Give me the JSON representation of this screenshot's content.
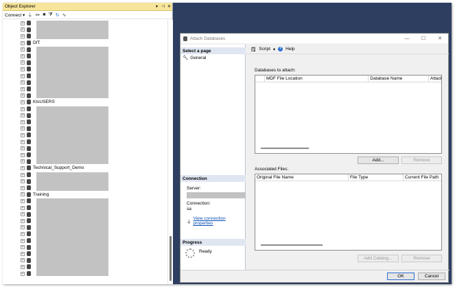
{
  "object_explorer": {
    "title": "Object Explorer",
    "pin": "▾ ⊣ ✕",
    "toolbar": {
      "connect_label": "Connect ▾"
    },
    "databases": [
      {
        "type": "redacted"
      },
      {
        "type": "redacted"
      },
      {
        "type": "redacted"
      },
      {
        "type": "named",
        "label": "DfT"
      },
      {
        "type": "redacted"
      },
      {
        "type": "redacted"
      },
      {
        "type": "redacted"
      },
      {
        "type": "redacted"
      },
      {
        "type": "redacted"
      },
      {
        "type": "redacted"
      },
      {
        "type": "redacted"
      },
      {
        "type": "redacted"
      },
      {
        "type": "named",
        "label": "KtsUSERS"
      },
      {
        "type": "redacted"
      },
      {
        "type": "redacted"
      },
      {
        "type": "redacted"
      },
      {
        "type": "redacted"
      },
      {
        "type": "redacted"
      },
      {
        "type": "redacted"
      },
      {
        "type": "redacted"
      },
      {
        "type": "redacted"
      },
      {
        "type": "redacted"
      },
      {
        "type": "named",
        "label": "Technical_Support_Demo"
      },
      {
        "type": "redacted"
      },
      {
        "type": "redacted"
      },
      {
        "type": "redacted"
      },
      {
        "type": "named",
        "label": "Training"
      },
      {
        "type": "redacted"
      },
      {
        "type": "redacted"
      },
      {
        "type": "redacted"
      },
      {
        "type": "redacted"
      },
      {
        "type": "redacted"
      },
      {
        "type": "redacted"
      },
      {
        "type": "redacted"
      },
      {
        "type": "redacted"
      },
      {
        "type": "redacted"
      },
      {
        "type": "redacted"
      },
      {
        "type": "redacted"
      },
      {
        "type": "redacted"
      }
    ]
  },
  "dialog": {
    "title": "Attach Databases",
    "select_page_heading": "Select a page",
    "pages": [
      {
        "label": "General"
      }
    ],
    "connection_heading": "Connection",
    "server_label": "Server:",
    "connection_label": "Connection:",
    "connection_value": "sa",
    "view_connection_link": "View connection properties",
    "progress_heading": "Progress",
    "progress_status": "Ready",
    "toolbar": {
      "script_label": "Script",
      "help_label": "Help"
    },
    "databases_to_attach_label": "Databases to attach:",
    "attach_columns": [
      "MDF File Location",
      "Database Name",
      "Attach"
    ],
    "add_button": "Add...",
    "remove_button": "Remove",
    "associated_files_label": "Associated Files:",
    "assoc_columns": [
      "Original File Name",
      "File Type",
      "Current File Path"
    ],
    "add_catalog_button": "Add Catalog...",
    "remove_button_2": "Remove",
    "ok_button": "OK",
    "cancel_button": "Cancel"
  }
}
